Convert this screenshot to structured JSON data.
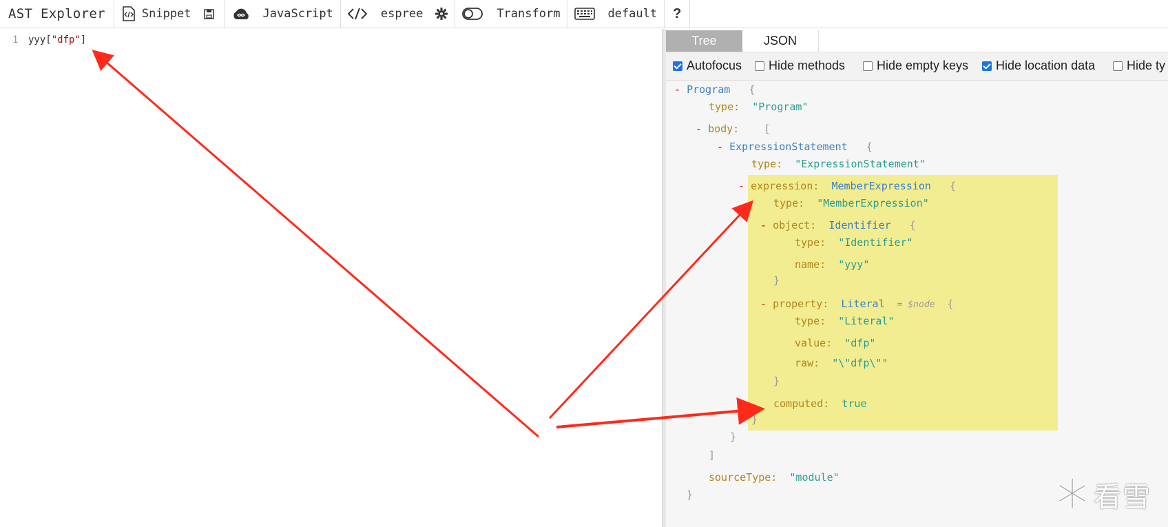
{
  "toolbar": {
    "title": "AST Explorer",
    "snippet": "Snippet",
    "language": "JavaScript",
    "parser": "espree",
    "transform": "Transform",
    "keymap": "default",
    "help": "?"
  },
  "editor": {
    "line_number": "1",
    "code_prefix": "yyy[",
    "code_string": "\"dfp\"",
    "code_suffix": "]"
  },
  "tabs": {
    "tree": "Tree",
    "json": "JSON"
  },
  "options": [
    {
      "label": "Autofocus",
      "checked": true
    },
    {
      "label": "Hide methods",
      "checked": false
    },
    {
      "label": "Hide empty keys",
      "checked": false
    },
    {
      "label": "Hide location data",
      "checked": true
    },
    {
      "label": "Hide ty",
      "checked": false
    }
  ],
  "tree": {
    "minus": "-",
    "open_brace": "{",
    "close_brace": "}",
    "open_bracket": "[",
    "close_bracket": "]",
    "program": "Program",
    "type_key": "type:",
    "program_type": "\"Program\"",
    "body_key": "body:",
    "expr_stmt": "ExpressionStatement",
    "expr_stmt_type": "\"ExpressionStatement\"",
    "expression_key": "expression:",
    "member_expr": "MemberExpression",
    "member_expr_type": "\"MemberExpression\"",
    "object_key": "object:",
    "identifier": "Identifier",
    "identifier_type": "\"Identifier\"",
    "name_key": "name:",
    "name_val": "\"yyy\"",
    "property_key": "property:",
    "literal": "Literal",
    "node_note": "= $node",
    "literal_type": "\"Literal\"",
    "value_key": "value:",
    "value_val": "\"dfp\"",
    "raw_key": "raw:",
    "raw_val": "\"\\\"dfp\\\"\"",
    "computed_key": "computed:",
    "computed_val": "true",
    "source_type_key": "sourceType:",
    "source_type_val": "\"module\""
  },
  "watermark": {
    "text": "看雪"
  },
  "colors": {
    "highlight": "#f3ed92",
    "arrow": "#ff2a1a",
    "tab_active": "#b0b0b0"
  }
}
